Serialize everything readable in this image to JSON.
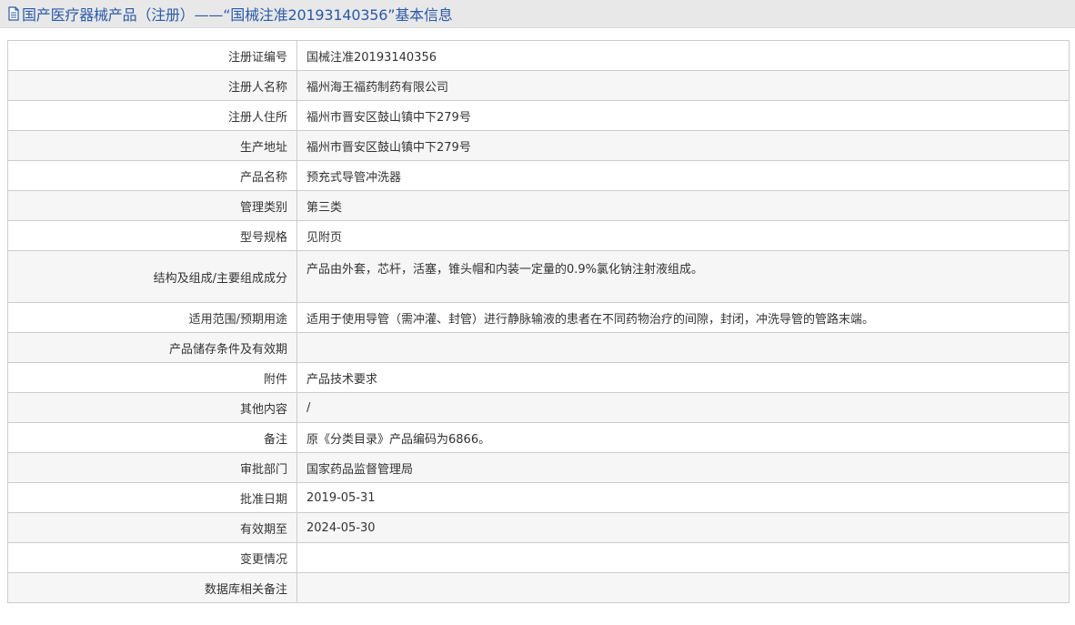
{
  "header": {
    "title": "国产医疗器械产品（注册）——“国械注准20193140356”基本信息",
    "icon": "document-icon"
  },
  "colors": {
    "title": "#2a5aa8",
    "header_bg": "#e8e8e8",
    "border": "#cccccc",
    "row_alt": "#f6f6f6"
  },
  "rows": [
    {
      "label": "注册证编号",
      "value": "国械注准20193140356"
    },
    {
      "label": "注册人名称",
      "value": "福州海王福药制药有限公司"
    },
    {
      "label": "注册人住所",
      "value": "福州市晋安区鼓山镇中下279号"
    },
    {
      "label": "生产地址",
      "value": "福州市晋安区鼓山镇中下279号"
    },
    {
      "label": "产品名称",
      "value": "预充式导管冲洗器"
    },
    {
      "label": "管理类别",
      "value": "第三类"
    },
    {
      "label": "型号规格",
      "value": "见附页"
    },
    {
      "label": "结构及组成/主要组成成分",
      "value": "产品由外套，芯杆，活塞，锥头帽和内装一定量的0.9%氯化钠注射液组成。"
    },
    {
      "label": "适用范围/预期用途",
      "value": "适用于使用导管（需冲灌、封管）进行静脉输液的患者在不同药物治疗的间隙，封闭，冲洗导管的管路末端。"
    },
    {
      "label": "产品储存条件及有效期",
      "value": ""
    },
    {
      "label": "附件",
      "value": "产品技术要求"
    },
    {
      "label": "其他内容",
      "value": "/"
    },
    {
      "label": "备注",
      "value": "原《分类目录》产品编码为6866。"
    },
    {
      "label": "审批部门",
      "value": "国家药品监督管理局"
    },
    {
      "label": "批准日期",
      "value": "2019-05-31"
    },
    {
      "label": "有效期至",
      "value": "2024-05-30"
    },
    {
      "label": "变更情况",
      "value": ""
    },
    {
      "label": "数据库相关备注",
      "value": ""
    }
  ]
}
